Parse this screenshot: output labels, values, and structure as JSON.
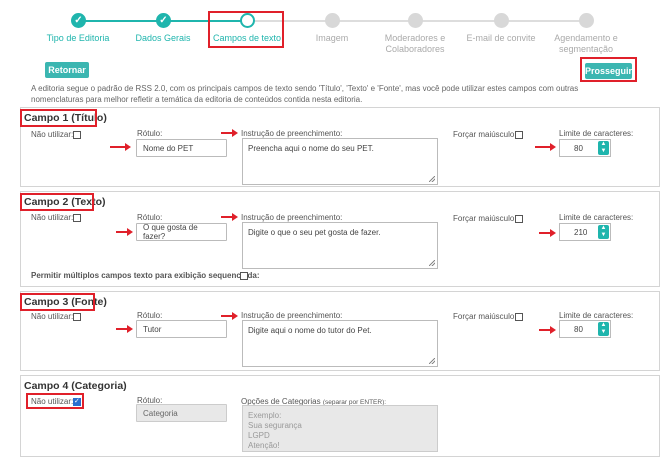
{
  "steps": [
    {
      "label": "Tipo de Editoria",
      "state": "done"
    },
    {
      "label": "Dados Gerais",
      "state": "done"
    },
    {
      "label": "Campos de texto",
      "state": "current"
    },
    {
      "label": "Imagem",
      "state": "todo"
    },
    {
      "label": "Moderadores e Colaboradores",
      "state": "todo"
    },
    {
      "label": "E-mail de convite",
      "state": "todo"
    },
    {
      "label": "Agendamento e segmentação",
      "state": "todo"
    }
  ],
  "buttons": {
    "back": "Retornar",
    "next": "Prosseguir"
  },
  "intro": "A editoria segue o padrão de RSS 2.0, com os principais campos de texto sendo 'Título', 'Texto' e 'Fonte', mas você pode utilizar estes campos com outras nomenclaturas para melhor refletir a temática da editoria de conteúdos contida nesta editoria.",
  "labels": {
    "nao_utilizar": "Não utilizar:",
    "rotulo": "Rótulo:",
    "instrucao": "Instrução de preenchimento:",
    "forcar": "Forçar maiúsculo:",
    "limite": "Limite de caracteres:",
    "opcoes": "Opções de Categorias",
    "opcoes_hint": "(separar por ENTER):",
    "multiplos": "Permitir múltiplos campos texto para exibição sequenciada:"
  },
  "fields": [
    {
      "title": "Campo 1 (Título)",
      "label_value": "Nome do PET",
      "instruction": "Preencha aqui o nome do seu PET.",
      "limit": "80"
    },
    {
      "title": "Campo 2 (Texto)",
      "label_value": "O que gosta de fazer?",
      "instruction": "Digite o que o seu pet gosta de fazer.",
      "limit": "210"
    },
    {
      "title": "Campo 3 (Fonte)",
      "label_value": "Tutor",
      "instruction": "Digite aqui o nome do tutor do Pet.",
      "limit": "80"
    },
    {
      "title": "Campo 4 (Categoria)",
      "label_value": "Categoria",
      "options_placeholder": "Exemplo:\nSua segurança\nLGPD\nAtenção!",
      "disabled": true
    }
  ],
  "colors": {
    "accent": "#1fb5ad",
    "highlight": "#e0202a"
  },
  "icons": {
    "step_done": "check-icon",
    "spinner": "spinner-arrows-icon",
    "annotation": "red-arrow-icon"
  }
}
